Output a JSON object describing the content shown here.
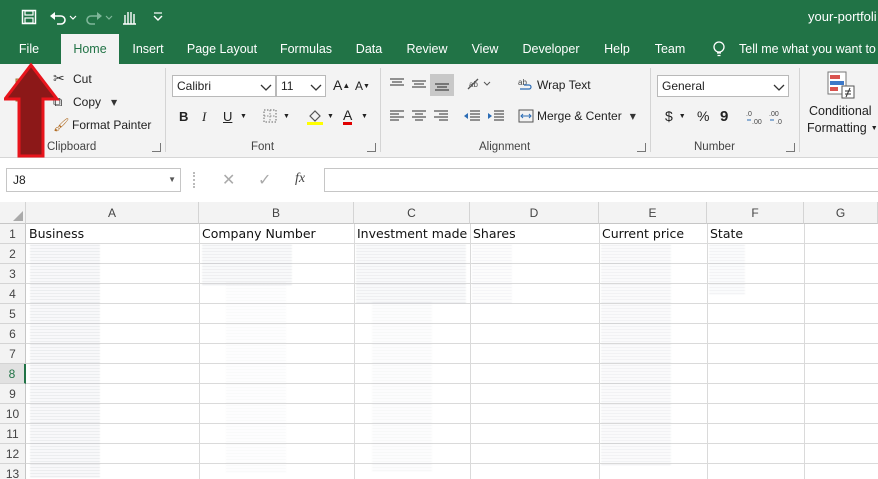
{
  "title_bar": {
    "document_title": "your-portfoli",
    "qat": [
      {
        "icon": "save-icon"
      },
      {
        "icon": "undo-icon"
      },
      {
        "icon": "redo-icon"
      },
      {
        "icon": "touch-mode-icon"
      },
      {
        "icon": "customize-qat-icon"
      }
    ]
  },
  "tabs": [
    "File",
    "Home",
    "Insert",
    "Page Layout",
    "Formulas",
    "Data",
    "Review",
    "View",
    "Developer",
    "Help",
    "Team"
  ],
  "active_tab": "Home",
  "tell_me": "Tell me what you want to d",
  "clipboard": {
    "cut": "Cut",
    "copy": "Copy",
    "format_painter": "Format Painter",
    "label": "Clipboard"
  },
  "font": {
    "name": "Calibri",
    "size": "11",
    "label": "Font",
    "bold": "B",
    "italic": "I",
    "underline": "U",
    "font_color_letter": "A",
    "grow": "A",
    "shrink": "A"
  },
  "alignment": {
    "wrap_text": "Wrap Text",
    "merge_center": "Merge & Center",
    "label": "Alignment"
  },
  "number": {
    "format": "General",
    "currency": "$",
    "percent": "%",
    "comma": "9",
    "label": "Number"
  },
  "styles": {
    "conditional_1": "Conditional",
    "conditional_2": "Formatting"
  },
  "formula_bar": {
    "name_box": "J8",
    "fx": "fx",
    "value": ""
  },
  "sheet": {
    "columns": [
      "A",
      "B",
      "C",
      "D",
      "E",
      "F",
      "G"
    ],
    "rows": [
      "1",
      "2",
      "3",
      "4",
      "5",
      "6",
      "7",
      "8",
      "9",
      "10",
      "11",
      "12",
      "13"
    ],
    "selected_row": "8",
    "headers": [
      "Business",
      "Company Number",
      "Investment made",
      "Shares",
      "Current price",
      "State"
    ]
  },
  "annotation": {
    "color": "#e8141c"
  }
}
